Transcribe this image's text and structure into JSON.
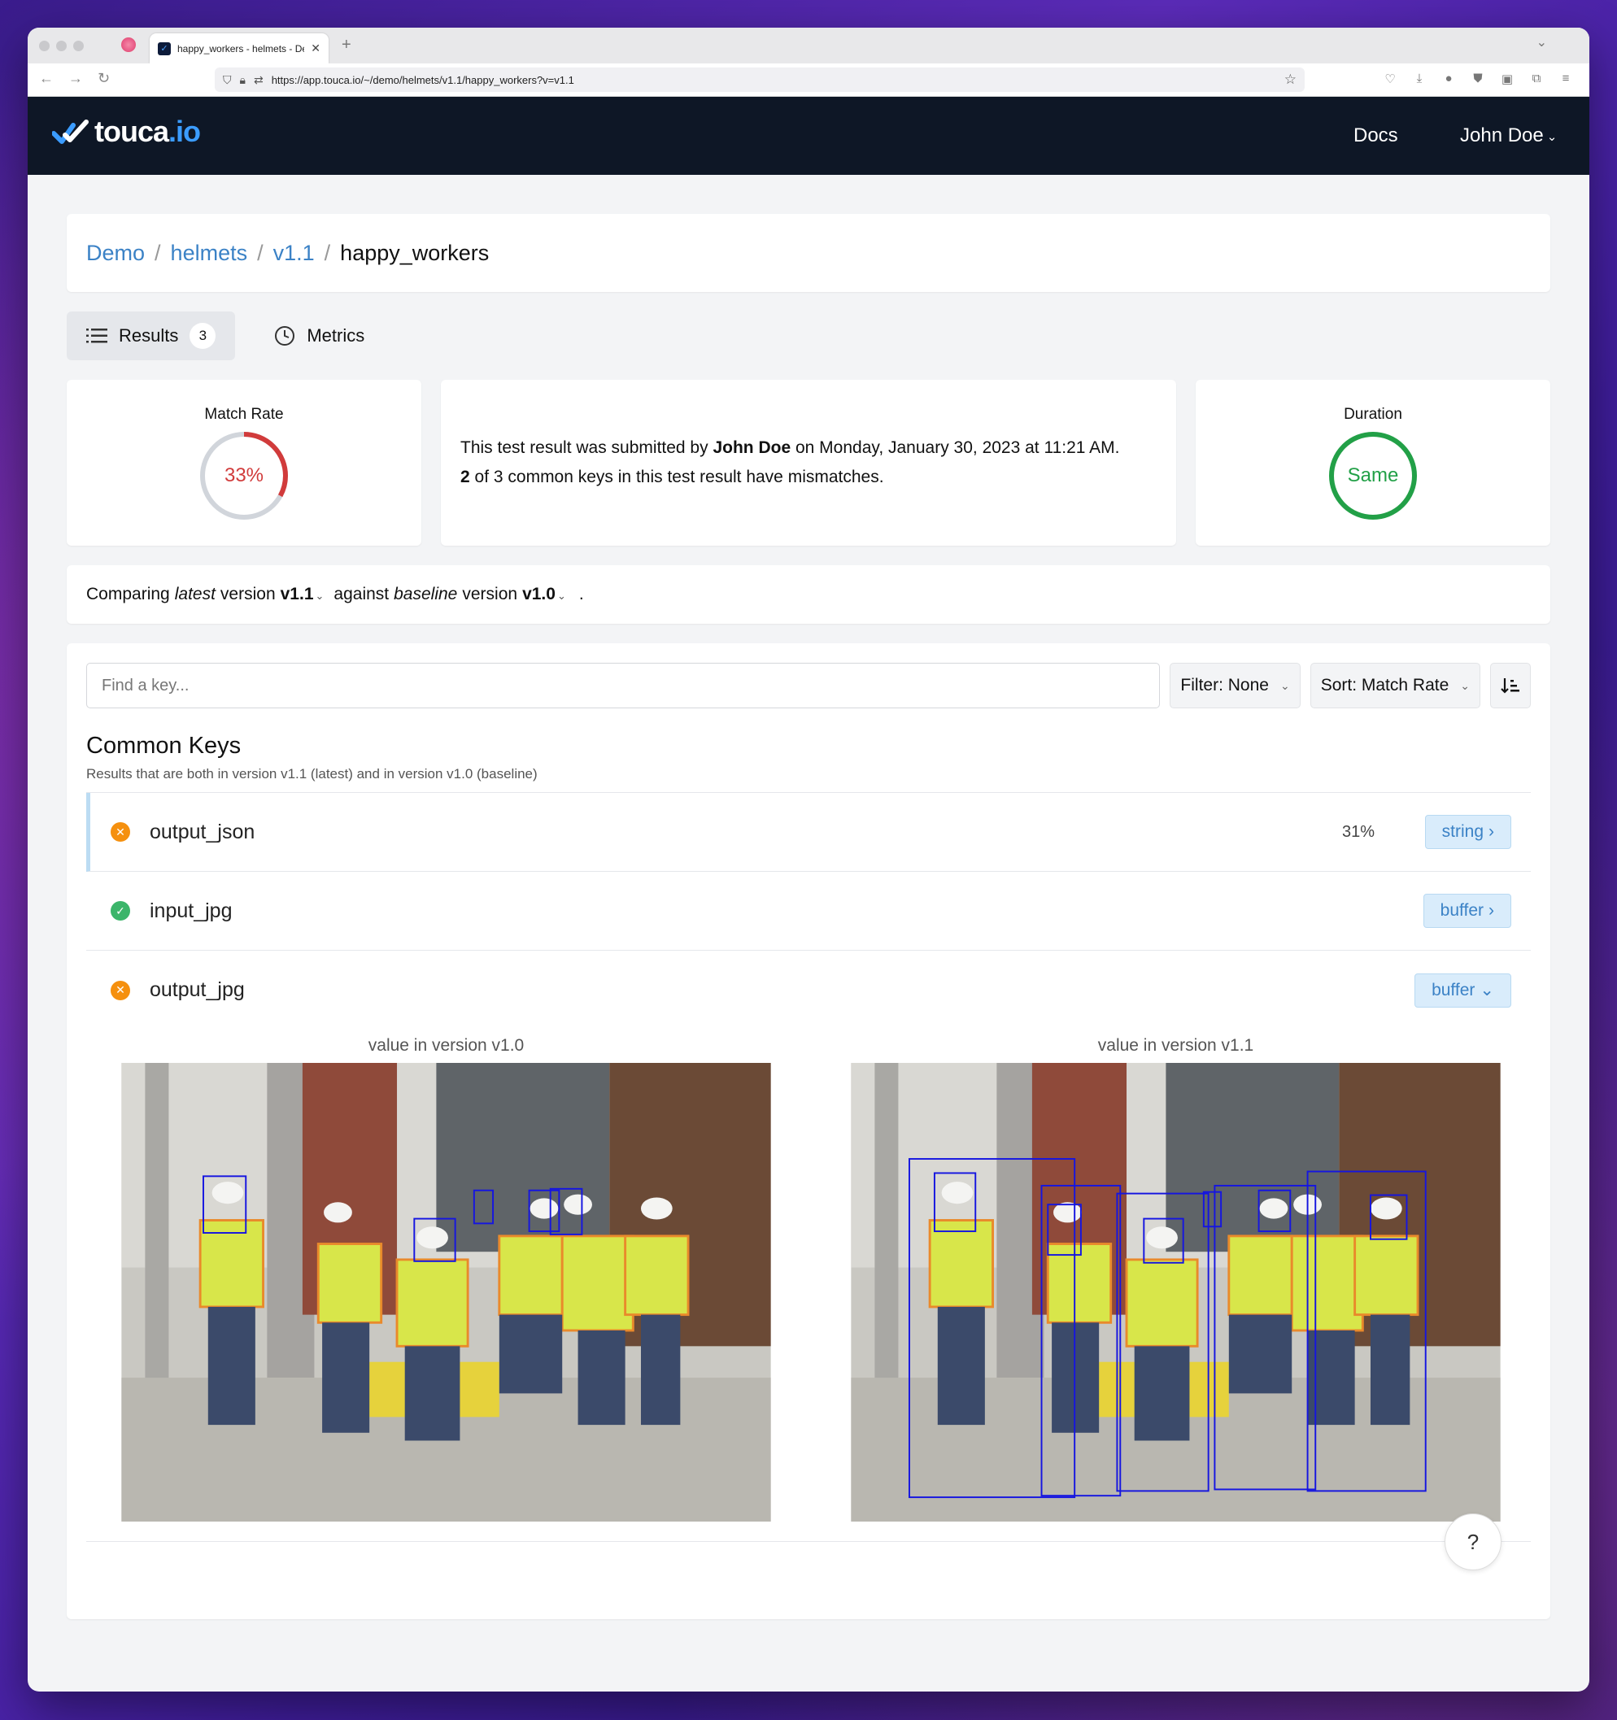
{
  "browser": {
    "tab_title": "happy_workers - helmets - Demo",
    "url": "https://app.touca.io/~/demo/helmets/v1.1/happy_workers?v=v1.1"
  },
  "header": {
    "logo_text_main": "touca",
    "logo_text_accent": ".io",
    "docs_label": "Docs",
    "user_label": "John Doe"
  },
  "breadcrumb": {
    "items": [
      "Demo",
      "helmets",
      "v1.1"
    ],
    "current": "happy_workers",
    "separator": "/"
  },
  "page_tabs": {
    "results_label": "Results",
    "results_count": "3",
    "metrics_label": "Metrics"
  },
  "match_rate": {
    "title": "Match Rate",
    "value_text": "33%",
    "value": 0.33,
    "color": "#d13b3b"
  },
  "summary": {
    "prefix": "This test result was submitted by",
    "author": "John Doe",
    "date_text": "on Monday, January 30, 2023 at 11:21 AM.",
    "mismatch_count": "2",
    "mismatch_text": "of 3 common keys in this test result have mismatches."
  },
  "duration": {
    "title": "Duration",
    "value_text": "Same",
    "color": "#22a047"
  },
  "comparison": {
    "word1": "Comparing",
    "latest_word": "latest",
    "word2": "version",
    "latest_version": "v1.1",
    "word3": "against",
    "baseline_word": "baseline",
    "word4": "version",
    "baseline_version": "v1.0",
    "end": "."
  },
  "filters": {
    "search_placeholder": "Find a key...",
    "filter_label": "Filter: None",
    "sort_label": "Sort: Match Rate"
  },
  "common_keys": {
    "title": "Common Keys",
    "subtitle": "Results that are both in version v1.1 (latest) and in version v1.0 (baseline)",
    "rows": [
      {
        "name": "output_json",
        "status": "fail",
        "rate": "31%",
        "type": "string"
      },
      {
        "name": "input_jpg",
        "status": "pass",
        "rate": "",
        "type": "buffer"
      },
      {
        "name": "output_jpg",
        "status": "fail",
        "rate": "",
        "type": "buffer"
      }
    ]
  },
  "image_compare": {
    "left_label": "value in version v1.0",
    "right_label": "value in version v1.1"
  },
  "help_label": "?"
}
